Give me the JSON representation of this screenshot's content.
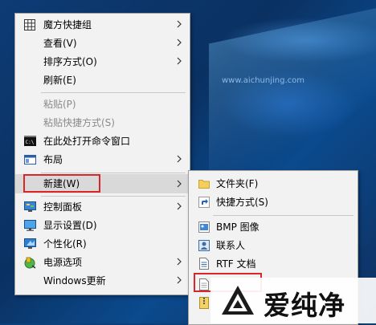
{
  "watermark": {
    "url": "www.aichunjing.com",
    "brand": "爱纯净"
  },
  "context_menu": {
    "items": [
      {
        "label": "魔方快捷组",
        "icon": "grid-icon",
        "submenu": true
      },
      {
        "label": "查看(V)",
        "submenu": true
      },
      {
        "label": "排序方式(O)",
        "submenu": true
      },
      {
        "label": "刷新(E)"
      },
      {
        "label": "粘贴(P)",
        "disabled": true
      },
      {
        "label": "粘贴快捷方式(S)",
        "disabled": true
      },
      {
        "label": "在此处打开命令窗口",
        "icon": "cmd-icon"
      },
      {
        "label": "布局",
        "icon": "layout-icon",
        "submenu": true
      },
      {
        "label": "新建(W)",
        "submenu": true,
        "highlighted": true
      },
      {
        "label": "控制面板",
        "icon": "control-panel-icon",
        "submenu": true
      },
      {
        "label": "显示设置(D)",
        "icon": "display-icon"
      },
      {
        "label": "个性化(R)",
        "icon": "personalize-icon"
      },
      {
        "label": "电源选项",
        "icon": "power-icon",
        "submenu": true
      },
      {
        "label": "Windows更新",
        "submenu": true
      }
    ]
  },
  "new_submenu": {
    "items": [
      {
        "label": "文件夹(F)",
        "icon": "folder-icon"
      },
      {
        "label": "快捷方式(S)",
        "icon": "shortcut-icon"
      },
      {
        "label": "BMP 图像",
        "icon": "bmp-icon"
      },
      {
        "label": "联系人",
        "icon": "contact-icon"
      },
      {
        "label": "RTF 文档",
        "icon": "rtf-icon"
      },
      {
        "label": "",
        "icon": "text-document-icon"
      },
      {
        "label": "",
        "icon": "zip-icon"
      }
    ]
  },
  "colors": {
    "highlight_box": "#d9262a",
    "menu_bg": "#f2f2f2"
  }
}
